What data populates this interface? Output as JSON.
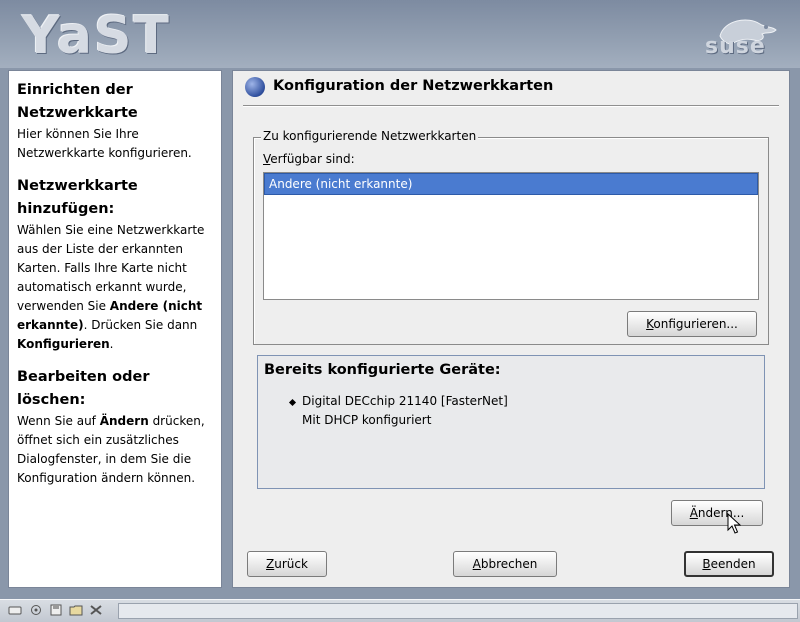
{
  "header": {
    "app_logo": "YaST",
    "brand_logo": "suse"
  },
  "help": {
    "section1_title": "Einrichten der Netzwerkkarte",
    "section1_text": "Hier können Sie Ihre Netzwerkkarte konfigurieren.",
    "section2_title": "Netzwerkkarte hinzufügen:",
    "section2_text_a": "Wählen Sie eine Netzwerkkarte aus der Liste der erkannten Karten. Falls Ihre Karte nicht automatisch erkannt wurde, verwenden Sie ",
    "section2_bold_a": "Andere (nicht erkannte)",
    "section2_text_b": ". Drücken Sie dann ",
    "section2_bold_b": "Konfigurieren",
    "section2_text_c": ".",
    "section3_title": "Bearbeiten oder löschen:",
    "section3_text_a": "Wenn Sie auf ",
    "section3_bold_a": "Ändern",
    "section3_text_b": " drücken, öffnet sich ein zusätzliches Dialogfenster, in dem Sie die Konfiguration ändern können."
  },
  "dialog": {
    "title": "Konfiguration der Netzwerkkarten",
    "frame_title": "Zu konfigurierende Netzwerkkarten",
    "available_label_u": "V",
    "available_label_rest": "erfügbar sind:",
    "list_items": [
      "Andere (nicht erkannte)"
    ],
    "configure_u": "K",
    "configure_rest": "onfigurieren...",
    "configured_title": "Bereits konfigurierte Geräte:",
    "device_name": "Digital DECchip 21140 [FasterNet]",
    "device_detail": "Mit DHCP konfiguriert",
    "change_u": "Ä",
    "change_rest": "ndern...",
    "back_u": "Z",
    "back_rest": "urück",
    "cancel_u": "A",
    "cancel_rest": "bbrechen",
    "finish_u": "B",
    "finish_rest": "eenden"
  },
  "icons": {
    "title": "globe-icon",
    "taskbar": [
      "menu-icon",
      "refresh-icon",
      "floppy-icon",
      "folder-icon",
      "tools-icon"
    ]
  },
  "colors": {
    "selection": "#4a7bd0",
    "header": "#8a97aa"
  }
}
